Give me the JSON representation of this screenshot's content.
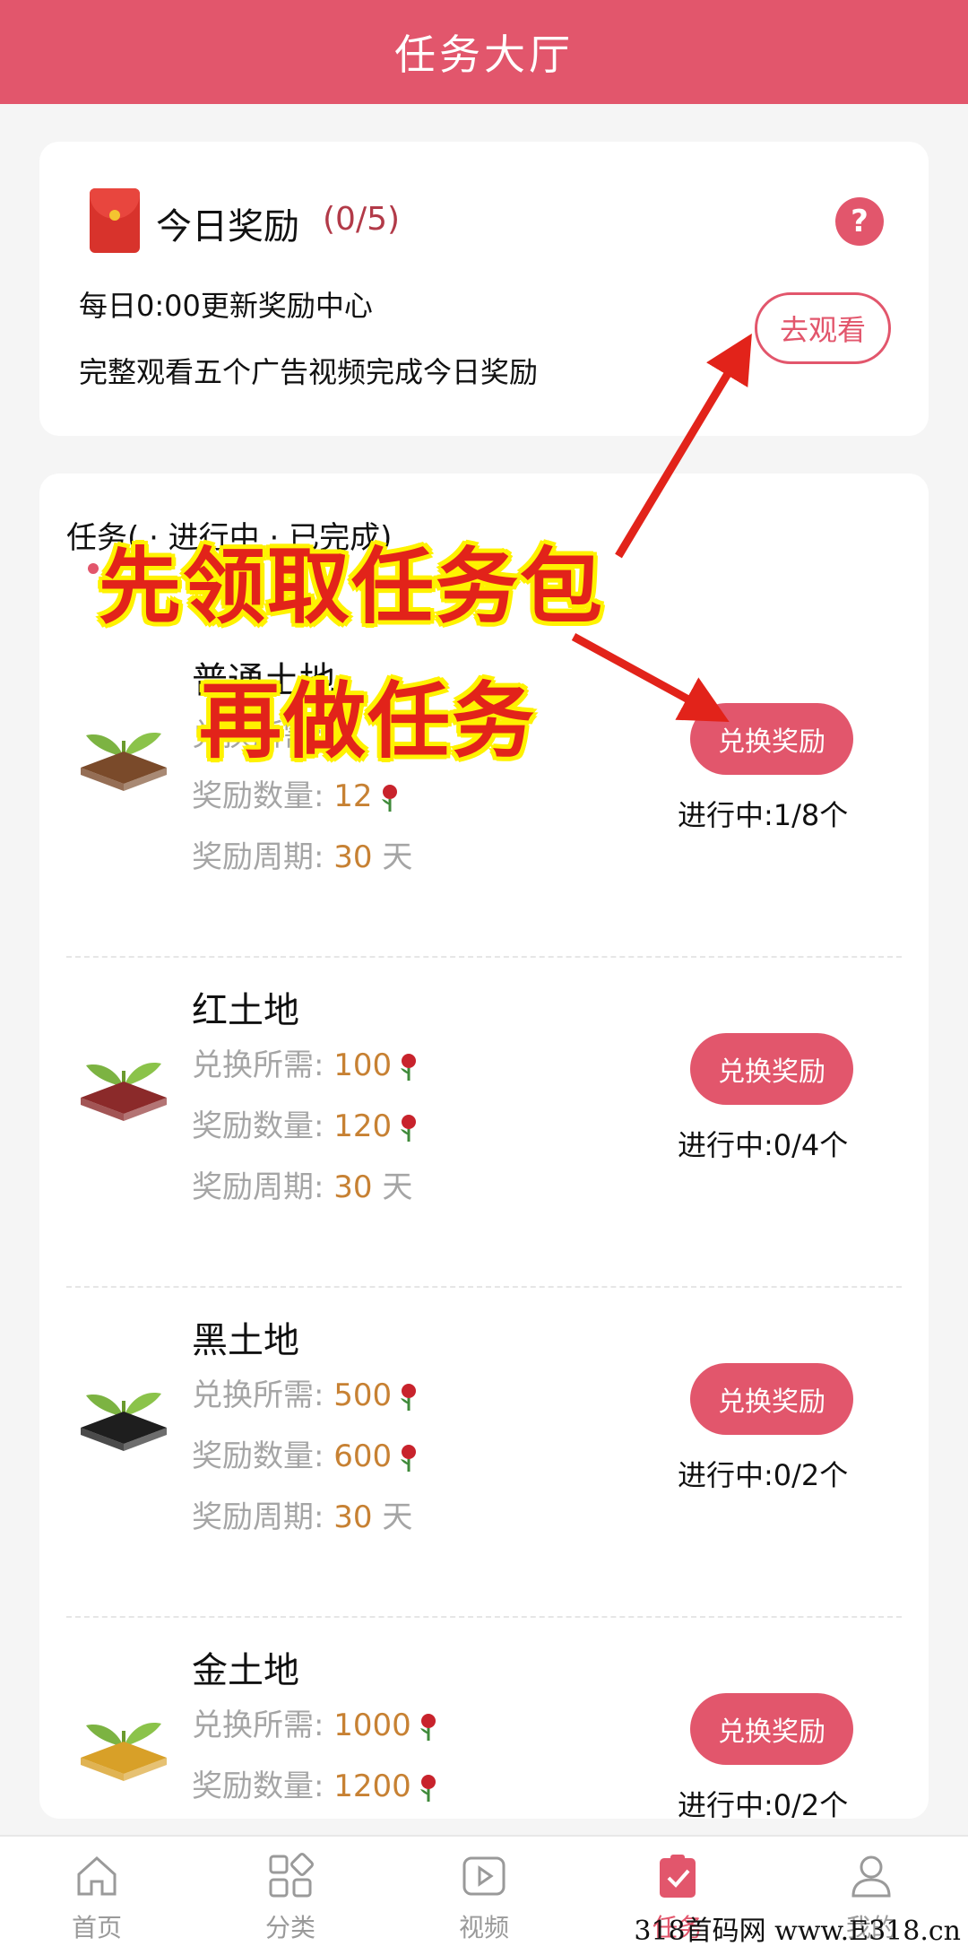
{
  "header": {
    "title": "任务大厅"
  },
  "reward": {
    "title": "今日奖励",
    "count": "(0/5)",
    "help_icon": "question-icon",
    "line1": "每日0:00更新奖励中心",
    "line2": "完整观看五个广告视频完成今日奖励",
    "watch_label": "去观看"
  },
  "tasks": {
    "tabs_partial": "任务(  ·  进行中  ·  已完成)",
    "items": [
      {
        "name": "普通土地",
        "need_label": "兑换所需:",
        "need_value": "",
        "qty_label": "奖励数量:",
        "qty_value": "12",
        "period_label": "奖励周期:",
        "period_value": "30",
        "period_unit": "天",
        "button": "兑换奖励",
        "progress": "进行中:1/8个",
        "soil_color": "#7a4a2a"
      },
      {
        "name": "红土地",
        "need_label": "兑换所需:",
        "need_value": "100",
        "qty_label": "奖励数量:",
        "qty_value": "120",
        "period_label": "奖励周期:",
        "period_value": "30",
        "period_unit": "天",
        "button": "兑换奖励",
        "progress": "进行中:0/4个",
        "soil_color": "#8b2a2a"
      },
      {
        "name": "黑土地",
        "need_label": "兑换所需:",
        "need_value": "500",
        "qty_label": "奖励数量:",
        "qty_value": "600",
        "period_label": "奖励周期:",
        "period_value": "30",
        "period_unit": "天",
        "button": "兑换奖励",
        "progress": "进行中:0/2个",
        "soil_color": "#1e1e1e"
      },
      {
        "name": "金土地",
        "need_label": "兑换所需:",
        "need_value": "1000",
        "qty_label": "奖励数量:",
        "qty_value": "1200",
        "period_label": "",
        "period_value": "",
        "period_unit": "",
        "button": "兑换奖励",
        "progress": "进行中:0/2个",
        "soil_color": "#d8a028"
      }
    ]
  },
  "overlay": {
    "line1": "先领取任务包",
    "line2": "再做任务"
  },
  "nav": [
    {
      "label": "首页",
      "icon": "home-icon"
    },
    {
      "label": "分类",
      "icon": "category-icon"
    },
    {
      "label": "视频",
      "icon": "video-icon"
    },
    {
      "label": "任务",
      "icon": "task-icon",
      "active": true
    },
    {
      "label": "我的",
      "icon": "profile-icon"
    }
  ],
  "watermark": "318首码网 www.E318.cn",
  "colors": {
    "accent": "#e2566c",
    "value": "#c78133",
    "label": "#a5a5a5",
    "overlay_text": "#e2231a",
    "overlay_outline": "#fff200"
  }
}
